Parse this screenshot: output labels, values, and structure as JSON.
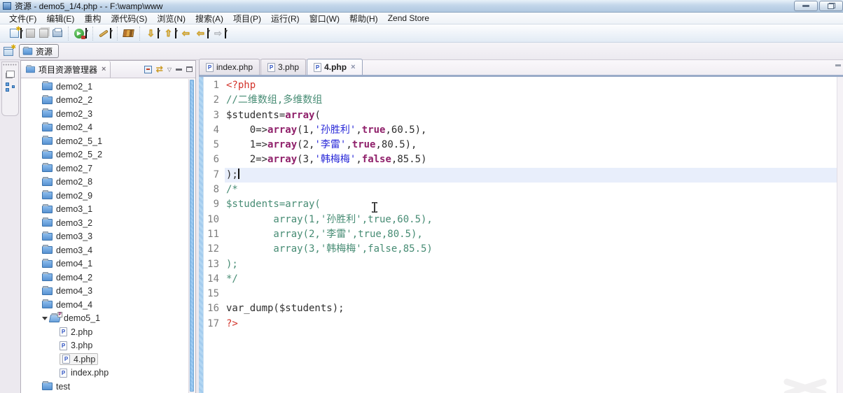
{
  "window": {
    "title": "资源 - demo5_1/4.php -  - F:\\wamp\\www"
  },
  "menu": {
    "items": [
      "文件(F)",
      "编辑(E)",
      "重构",
      "源代码(S)",
      "浏览(N)",
      "搜索(A)",
      "项目(P)",
      "运行(R)",
      "窗口(W)",
      "帮助(H)",
      "Zend Store"
    ]
  },
  "toolbar": {
    "buttons": [
      {
        "name": "new-wizard",
        "icon": "new-file-icon",
        "dropdown": true
      },
      {
        "name": "save",
        "icon": "save-icon",
        "disabled": true
      },
      {
        "name": "save-all",
        "icon": "save-all-icon",
        "disabled": true
      },
      {
        "name": "print",
        "icon": "print-icon",
        "group_end": true
      },
      {
        "name": "debug-run",
        "icon": "run-icon",
        "dropdown": true,
        "group_end": true
      },
      {
        "name": "edit-marker",
        "icon": "pencil-icon",
        "dropdown": true,
        "group_end": true
      },
      {
        "name": "library",
        "icon": "books-icon",
        "group_end": true
      },
      {
        "name": "last-edit-location",
        "icon": "yellow-arrow-down-icon",
        "glyph": "⇩",
        "dropdown": true
      },
      {
        "name": "next-edit-location",
        "icon": "yellow-arrow-up-icon",
        "glyph": "⇧",
        "dropdown": true
      },
      {
        "name": "back-to-last-edit",
        "icon": "yellow-arrow-left-star-icon",
        "glyph": "⇦"
      },
      {
        "name": "back",
        "icon": "yellow-arrow-left-icon",
        "glyph": "⇦",
        "dropdown": true
      },
      {
        "name": "forward",
        "icon": "gray-arrow-right-icon",
        "glyph": "⇨",
        "disabled": true,
        "dropdown": true
      }
    ]
  },
  "perspective": {
    "active_label": "资源"
  },
  "explorer": {
    "title": "项目资源管理器",
    "close_glyph": "×",
    "tools": [
      "collapse-all",
      "link-with-editor",
      "view-menu",
      "minimize-view",
      "maximize-view"
    ],
    "link_glyph": "⇄",
    "view_menu_glyph": "▽",
    "items": [
      {
        "label": "demo2_1",
        "type": "folder",
        "level": 0
      },
      {
        "label": "demo2_2",
        "type": "folder",
        "level": 0
      },
      {
        "label": "demo2_3",
        "type": "folder",
        "level": 0
      },
      {
        "label": "demo2_4",
        "type": "folder",
        "level": 0
      },
      {
        "label": "demo2_5_1",
        "type": "folder",
        "level": 0
      },
      {
        "label": "demo2_5_2",
        "type": "folder",
        "level": 0
      },
      {
        "label": "demo2_7",
        "type": "folder",
        "level": 0
      },
      {
        "label": "demo2_8",
        "type": "folder",
        "level": 0
      },
      {
        "label": "demo2_9",
        "type": "folder",
        "level": 0
      },
      {
        "label": "demo3_1",
        "type": "folder",
        "level": 0
      },
      {
        "label": "demo3_2",
        "type": "folder",
        "level": 0
      },
      {
        "label": "demo3_3",
        "type": "folder",
        "level": 0
      },
      {
        "label": "demo3_4",
        "type": "folder",
        "level": 0
      },
      {
        "label": "demo4_1",
        "type": "folder",
        "level": 0
      },
      {
        "label": "demo4_2",
        "type": "folder",
        "level": 0
      },
      {
        "label": "demo4_3",
        "type": "folder",
        "level": 0
      },
      {
        "label": "demo4_4",
        "type": "folder",
        "level": 0
      },
      {
        "label": "demo5_1",
        "type": "folder-open",
        "level": 0,
        "expanded": true
      },
      {
        "label": "2.php",
        "type": "php",
        "level": 1
      },
      {
        "label": "3.php",
        "type": "php",
        "level": 1
      },
      {
        "label": "4.php",
        "type": "php",
        "level": 1,
        "selected": true
      },
      {
        "label": "index.php",
        "type": "php",
        "level": 1
      },
      {
        "label": "test",
        "type": "folder",
        "level": 0
      }
    ]
  },
  "editor": {
    "tabs": [
      {
        "label": "index.php",
        "active": false
      },
      {
        "label": "3.php",
        "active": false
      },
      {
        "label": "4.php",
        "active": true,
        "close_glyph": "×"
      }
    ],
    "lines": [
      {
        "n": "1",
        "segs": [
          {
            "t": "<?php",
            "c": "tag"
          }
        ]
      },
      {
        "n": "2",
        "segs": [
          {
            "t": "//二维数组,多维数组",
            "c": "comment"
          }
        ]
      },
      {
        "n": "3",
        "segs": [
          {
            "t": "$students=",
            "c": "plain"
          },
          {
            "t": "array",
            "c": "keyword"
          },
          {
            "t": "(",
            "c": "plain"
          }
        ]
      },
      {
        "n": "4",
        "segs": [
          {
            "t": "    0=>",
            "c": "plain"
          },
          {
            "t": "array",
            "c": "keyword"
          },
          {
            "t": "(1,",
            "c": "plain"
          },
          {
            "t": "'孙胜利'",
            "c": "string"
          },
          {
            "t": ",",
            "c": "plain"
          },
          {
            "t": "true",
            "c": "keyword"
          },
          {
            "t": ",60.5),",
            "c": "plain"
          }
        ]
      },
      {
        "n": "5",
        "segs": [
          {
            "t": "    1=>",
            "c": "plain"
          },
          {
            "t": "array",
            "c": "keyword"
          },
          {
            "t": "(2,",
            "c": "plain"
          },
          {
            "t": "'李雷'",
            "c": "string"
          },
          {
            "t": ",",
            "c": "plain"
          },
          {
            "t": "true",
            "c": "keyword"
          },
          {
            "t": ",80.5),",
            "c": "plain"
          }
        ]
      },
      {
        "n": "6",
        "segs": [
          {
            "t": "    2=>",
            "c": "plain"
          },
          {
            "t": "array",
            "c": "keyword"
          },
          {
            "t": "(3,",
            "c": "plain"
          },
          {
            "t": "'韩梅梅'",
            "c": "string"
          },
          {
            "t": ",",
            "c": "plain"
          },
          {
            "t": "false",
            "c": "keyword"
          },
          {
            "t": ",85.5)",
            "c": "plain"
          }
        ]
      },
      {
        "n": "7",
        "segs": [
          {
            "t": ");",
            "c": "plain"
          }
        ],
        "current": true,
        "caret": true
      },
      {
        "n": "8",
        "segs": [
          {
            "t": "/*",
            "c": "comment"
          }
        ]
      },
      {
        "n": "9",
        "segs": [
          {
            "t": "$students=array(",
            "c": "comment"
          }
        ]
      },
      {
        "n": "10",
        "segs": [
          {
            "t": "        array(1,'孙胜利',true,60.5),",
            "c": "comment"
          }
        ]
      },
      {
        "n": "11",
        "segs": [
          {
            "t": "        array(2,'李雷',true,80.5),",
            "c": "comment"
          }
        ]
      },
      {
        "n": "12",
        "segs": [
          {
            "t": "        array(3,'韩梅梅',false,85.5)",
            "c": "comment"
          }
        ]
      },
      {
        "n": "13",
        "segs": [
          {
            "t": ");",
            "c": "comment"
          }
        ]
      },
      {
        "n": "14",
        "segs": [
          {
            "t": "*/",
            "c": "comment"
          }
        ]
      },
      {
        "n": "15",
        "segs": []
      },
      {
        "n": "16",
        "segs": [
          {
            "t": "var_dump($students);",
            "c": "plain"
          }
        ]
      },
      {
        "n": "17",
        "segs": [
          {
            "t": "?>",
            "c": "tag"
          }
        ]
      }
    ]
  },
  "colors": {
    "php_tag": "#d3342b",
    "comment": "#478C74",
    "keyword": "#90216B",
    "string": "#2A2AD8",
    "plain": "#2e2e2e",
    "current_line": "#e8eefb",
    "diff_strip": "#a4ccee",
    "explorer_scroll_thumb": "#8ec0ec",
    "tab_underline": "#9aabc8",
    "titlebar_top": "#e8f1f9",
    "titlebar_bottom": "#b0c8e0"
  }
}
